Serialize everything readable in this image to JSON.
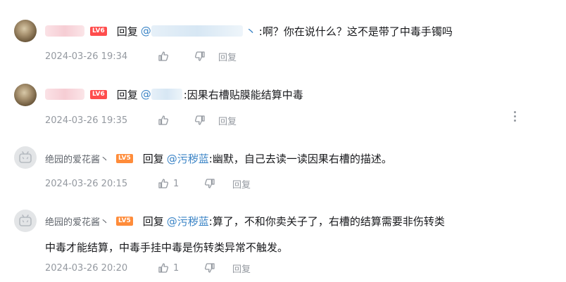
{
  "replies": [
    {
      "level": "LV6",
      "reply_word": "回复",
      "mention": "@",
      "trail": "丶",
      "content": ":啊？你在说什么？这不是带了中毒手镯吗",
      "time": "2024-03-26 19:34",
      "reply_label": "回复"
    },
    {
      "level": "LV6",
      "reply_word": "回复",
      "mention": "@",
      "content": ":因果右槽贴膜能结算中毒",
      "time": "2024-03-26 19:35",
      "reply_label": "回复"
    },
    {
      "username": "绝园的爱花酱丶",
      "level": "LV5",
      "reply_word": "回复",
      "mention": "@污秽蓝",
      "content": ":幽默，自己去读一读因果右槽的描述。",
      "time": "2024-03-26 20:15",
      "likes": "1",
      "reply_label": "回复"
    },
    {
      "username": "绝园的爱花酱丶",
      "level": "LV5",
      "reply_word": "回复",
      "mention": "@污秽蓝",
      "content": ":算了，不和你卖关子了，右槽的结算需要非伤转类",
      "content_line2": "中毒才能结算，中毒手挂中毒是伤转类异常不触发。",
      "time": "2024-03-26 20:20",
      "likes": "1",
      "reply_label": "回复"
    }
  ],
  "icons": {
    "like": "thumbs-up-icon",
    "dislike": "thumbs-down-icon",
    "more": "more-vertical-icon"
  },
  "colors": {
    "mention": "#3b84c6",
    "lv6": "#ff4d4d",
    "lv5": "#ff8c3a",
    "meta": "#9499a0"
  }
}
